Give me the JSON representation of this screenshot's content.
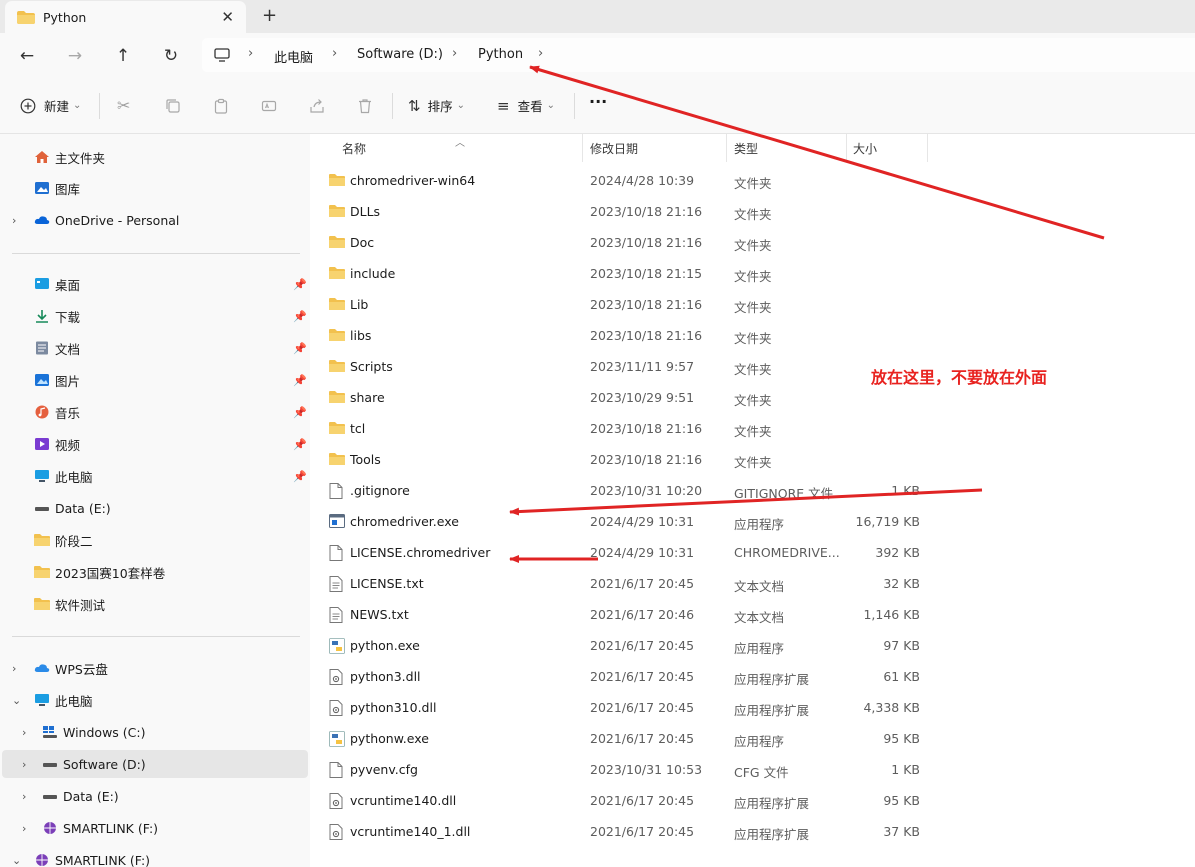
{
  "tab": {
    "title": "Python",
    "close_glyph": "✕",
    "new_glyph": "+"
  },
  "nav": {
    "back": "←",
    "forward": "→",
    "up": "↑",
    "refresh": "↻"
  },
  "breadcrumb": {
    "items": [
      "此电脑",
      "Software (D:)",
      "Python"
    ],
    "sep": "›"
  },
  "toolbar": {
    "new_label": "新建",
    "sort_label": "排序",
    "view_label": "查看",
    "more_glyph": "···",
    "dropdown_glyph": "⌄"
  },
  "sidebar": {
    "quick": [
      {
        "label": "主文件夹",
        "icon": "home-icon"
      },
      {
        "label": "图库",
        "icon": "gallery-icon"
      },
      {
        "label": "OneDrive - Personal",
        "icon": "cloud-icon"
      }
    ],
    "pinned": [
      {
        "label": "桌面",
        "icon": "desktop-icon"
      },
      {
        "label": "下载",
        "icon": "download-icon"
      },
      {
        "label": "文档",
        "icon": "document-icon"
      },
      {
        "label": "图片",
        "icon": "picture-icon"
      },
      {
        "label": "音乐",
        "icon": "music-icon"
      },
      {
        "label": "视频",
        "icon": "video-icon"
      },
      {
        "label": "此电脑",
        "icon": "computer-icon"
      },
      {
        "label": "Data (E:)",
        "icon": "drive-icon"
      },
      {
        "label": "阶段二",
        "icon": "folder-icon"
      },
      {
        "label": "2023国赛10套样卷",
        "icon": "folder-icon"
      },
      {
        "label": "软件测试",
        "icon": "folder-icon"
      }
    ],
    "tree": [
      {
        "label": "WPS云盘",
        "icon": "cloud-icon"
      },
      {
        "label": "此电脑",
        "icon": "computer-icon"
      },
      {
        "label": "Windows (C:)",
        "icon": "windows-drive-icon"
      },
      {
        "label": "Software (D:)",
        "icon": "drive-icon"
      },
      {
        "label": "Data (E:)",
        "icon": "drive-icon"
      },
      {
        "label": "SMARTLINK (F:)",
        "icon": "globe-drive-icon"
      },
      {
        "label": "SMARTLINK (F:)",
        "icon": "globe-drive-icon"
      }
    ]
  },
  "columns": {
    "name": "名称",
    "date": "修改日期",
    "type": "类型",
    "size": "大小"
  },
  "files": [
    {
      "name": "chromedriver-win64",
      "date": "2024/4/28 10:39",
      "type": "文件夹",
      "size": "",
      "icon": "folder-icon"
    },
    {
      "name": "DLLs",
      "date": "2023/10/18 21:16",
      "type": "文件夹",
      "size": "",
      "icon": "folder-icon"
    },
    {
      "name": "Doc",
      "date": "2023/10/18 21:16",
      "type": "文件夹",
      "size": "",
      "icon": "folder-icon"
    },
    {
      "name": "include",
      "date": "2023/10/18 21:15",
      "type": "文件夹",
      "size": "",
      "icon": "folder-icon"
    },
    {
      "name": "Lib",
      "date": "2023/10/18 21:16",
      "type": "文件夹",
      "size": "",
      "icon": "folder-icon"
    },
    {
      "name": "libs",
      "date": "2023/10/18 21:16",
      "type": "文件夹",
      "size": "",
      "icon": "folder-icon"
    },
    {
      "name": "Scripts",
      "date": "2023/11/11 9:57",
      "type": "文件夹",
      "size": "",
      "icon": "folder-icon"
    },
    {
      "name": "share",
      "date": "2023/10/29 9:51",
      "type": "文件夹",
      "size": "",
      "icon": "folder-icon"
    },
    {
      "name": "tcl",
      "date": "2023/10/18 21:16",
      "type": "文件夹",
      "size": "",
      "icon": "folder-icon"
    },
    {
      "name": "Tools",
      "date": "2023/10/18 21:16",
      "type": "文件夹",
      "size": "",
      "icon": "folder-icon"
    },
    {
      "name": ".gitignore",
      "date": "2023/10/31 10:20",
      "type": "GITIGNORE 文件",
      "size": "1 KB",
      "icon": "file-icon"
    },
    {
      "name": "chromedriver.exe",
      "date": "2024/4/29 10:31",
      "type": "应用程序",
      "size": "16,719 KB",
      "icon": "exe-icon"
    },
    {
      "name": "LICENSE.chromedriver",
      "date": "2024/4/29 10:31",
      "type": "CHROMEDRIVE...",
      "size": "392 KB",
      "icon": "file-icon"
    },
    {
      "name": "LICENSE.txt",
      "date": "2021/6/17 20:45",
      "type": "文本文档",
      "size": "32 KB",
      "icon": "text-file-icon"
    },
    {
      "name": "NEWS.txt",
      "date": "2021/6/17 20:46",
      "type": "文本文档",
      "size": "1,146 KB",
      "icon": "text-file-icon"
    },
    {
      "name": "python.exe",
      "date": "2021/6/17 20:45",
      "type": "应用程序",
      "size": "97 KB",
      "icon": "python-icon"
    },
    {
      "name": "python3.dll",
      "date": "2021/6/17 20:45",
      "type": "应用程序扩展",
      "size": "61 KB",
      "icon": "dll-icon"
    },
    {
      "name": "python310.dll",
      "date": "2021/6/17 20:45",
      "type": "应用程序扩展",
      "size": "4,338 KB",
      "icon": "dll-icon"
    },
    {
      "name": "pythonw.exe",
      "date": "2021/6/17 20:45",
      "type": "应用程序",
      "size": "95 KB",
      "icon": "python-icon"
    },
    {
      "name": "pyvenv.cfg",
      "date": "2023/10/31 10:53",
      "type": "CFG 文件",
      "size": "1 KB",
      "icon": "file-icon"
    },
    {
      "name": "vcruntime140.dll",
      "date": "2021/6/17 20:45",
      "type": "应用程序扩展",
      "size": "95 KB",
      "icon": "dll-icon"
    },
    {
      "name": "vcruntime140_1.dll",
      "date": "2021/6/17 20:45",
      "type": "应用程序扩展",
      "size": "37 KB",
      "icon": "dll-icon"
    }
  ],
  "annotation": {
    "text": "放在这里，不要放在外面",
    "color": "#e8221f"
  },
  "colors": {
    "folder": "#f2c14e",
    "accent": "#0067c0",
    "arrow": "#e02424"
  }
}
